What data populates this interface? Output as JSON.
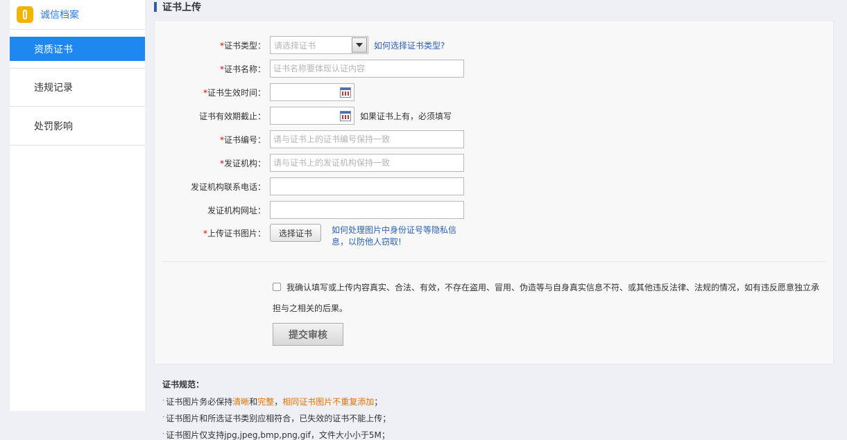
{
  "sidebar": {
    "header": "诚信档案",
    "items": [
      {
        "label": "资质证书",
        "active": true
      },
      {
        "label": "违规记录",
        "active": false
      },
      {
        "label": "处罚影响",
        "active": false
      }
    ]
  },
  "section_title": "证书上传",
  "form": {
    "cert_type": {
      "label": "证书类型：",
      "placeholder": "请选择证书",
      "help_link": "如何选择证书类型?"
    },
    "cert_name": {
      "label": "证书名称：",
      "placeholder": "证书名称要体现认证内容"
    },
    "effective_date": {
      "label": "证书生效时间："
    },
    "expiry_date": {
      "label": "证书有效期截止：",
      "hint": "如果证书上有，必须填写"
    },
    "cert_number": {
      "label": "证书编号：",
      "placeholder": "请与证书上的证书编号保持一致"
    },
    "issuer": {
      "label": "发证机构：",
      "placeholder": "请与证书上的发证机构保持一致"
    },
    "issuer_phone": {
      "label": "发证机构联系电话："
    },
    "issuer_site": {
      "label": "发证机构网址："
    },
    "upload": {
      "label": "上传证书图片：",
      "button": "选择证书",
      "help_link_1": "如何处理图片中身份证号等隐私信",
      "help_link_2": "息，以防他人窃取!"
    },
    "required_mark": "*",
    "agreement_line1": "我确认填写或上传内容真实、合法、有效，不存在盗用、冒用、伪造等与自身真实信息不符、或其他违反法律、法规的情况，如有违反愿意独立承",
    "agreement_line2": "担与之相关的后果。",
    "submit": "提交审核"
  },
  "spec": {
    "title": "证书规范：",
    "bullet": "·",
    "rule1_a": "证书图片务必保持",
    "rule1_b": "清晰",
    "rule1_c": "和",
    "rule1_d": "完整",
    "rule1_e": "，",
    "rule1_f": "相同证书图片不重复添加",
    "rule1_g": "；",
    "rule2": "证书图片和所选证书类别应相符合，已失效的证书不能上传；",
    "rule3": "证书图片仅支持jpg,jpeg,bmp,png,gif，文件大小小于5M；"
  },
  "colors": {
    "accent": "#1e88f0",
    "link": "#2a62b7",
    "highlight": "#e87000",
    "required": "#dd0000"
  }
}
